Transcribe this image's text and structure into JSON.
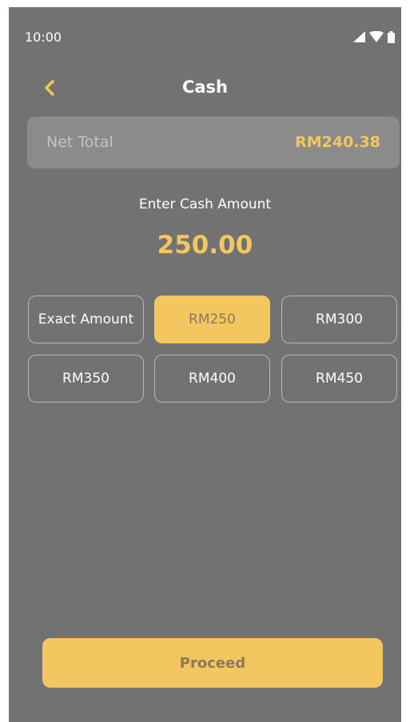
{
  "status_bar": {
    "time": "10:00",
    "icons": [
      "cellular-signal-icon",
      "wifi-icon",
      "battery-icon"
    ]
  },
  "header": {
    "back_icon": "chevron-left-icon",
    "title": "Cash"
  },
  "net_total": {
    "label": "Net Total",
    "value": "RM240.38"
  },
  "cash_entry": {
    "label": "Enter Cash Amount",
    "amount": "250.00"
  },
  "amount_options": [
    {
      "label": "Exact Amount",
      "selected": false
    },
    {
      "label": "RM250",
      "selected": true
    },
    {
      "label": "RM300",
      "selected": false
    },
    {
      "label": "RM350",
      "selected": false
    },
    {
      "label": "RM400",
      "selected": false
    },
    {
      "label": "RM450",
      "selected": false
    }
  ],
  "proceed": {
    "label": "Proceed"
  },
  "colors": {
    "background": "#727272",
    "accent": "#f4c660",
    "card": "#8b8b8b",
    "button_border": "#b7b7b7"
  }
}
